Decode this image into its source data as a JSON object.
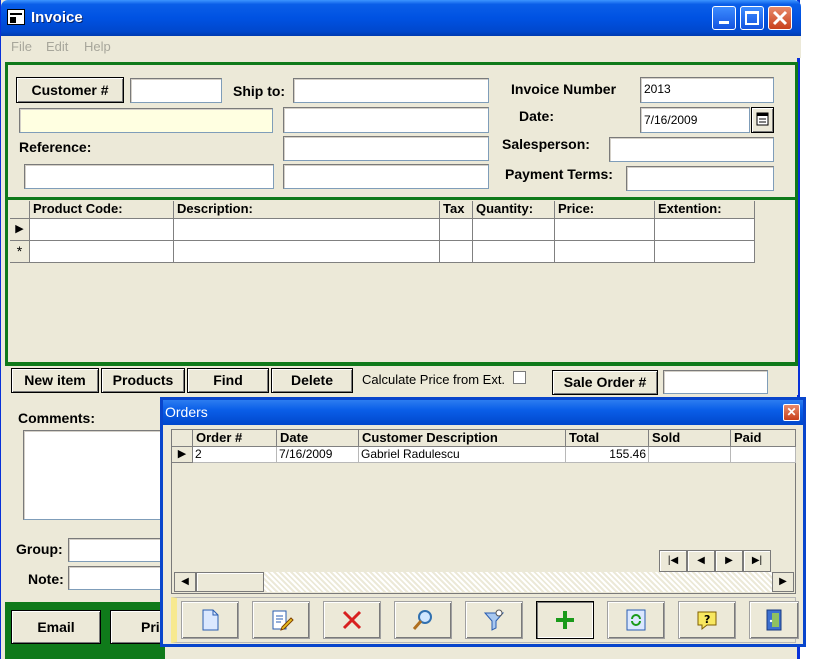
{
  "window": {
    "title": "Invoice"
  },
  "menu": [
    "File",
    "Edit",
    "Help"
  ],
  "header": {
    "customer_button": "Customer #",
    "customer_value": "",
    "ship_to_label": "Ship to:",
    "reference_label": "Reference:",
    "invoice_number_label": "Invoice Number",
    "invoice_number_value": "2013",
    "date_label": "Date:",
    "date_value": "7/16/2009",
    "salesperson_label": "Salesperson:",
    "payment_terms_label": "Payment Terms:"
  },
  "items_grid": {
    "columns": [
      "Product Code:",
      "Description:",
      "Tax",
      "Quantity:",
      "Price:",
      "Extention:"
    ],
    "row_markers": [
      "▶",
      "*"
    ]
  },
  "actions": {
    "new_item": "New item",
    "products": "Products",
    "find": "Find",
    "delete": "Delete",
    "calc_label": "Calculate Price from Ext.",
    "sale_order": "Sale Order #"
  },
  "lower": {
    "comments_label": "Comments:",
    "group_label": "Group:",
    "note_label": "Note:",
    "email_button": "Email",
    "print_button_partial": "Pri"
  },
  "orders": {
    "title": "Orders",
    "columns": [
      "Order #",
      "Date",
      "Customer Description",
      "Total",
      "Sold",
      "Paid"
    ],
    "rows": [
      {
        "order": "2",
        "date": "7/16/2009",
        "customer": "Gabriel Radulescu",
        "total": "155.46",
        "sold": "",
        "paid": ""
      }
    ],
    "nav": [
      "|◀",
      "◀",
      "▶",
      "▶|"
    ],
    "toolbar_icons": [
      "new-document-icon",
      "edit-icon",
      "delete-icon",
      "search-icon",
      "filter-icon",
      "add-icon",
      "refresh-icon",
      "help-icon",
      "exit-icon"
    ]
  },
  "colors": {
    "title_blue": "#0052e2",
    "frame_green": "#0f7a1a",
    "readonly_yellow": "#ffffe1"
  }
}
